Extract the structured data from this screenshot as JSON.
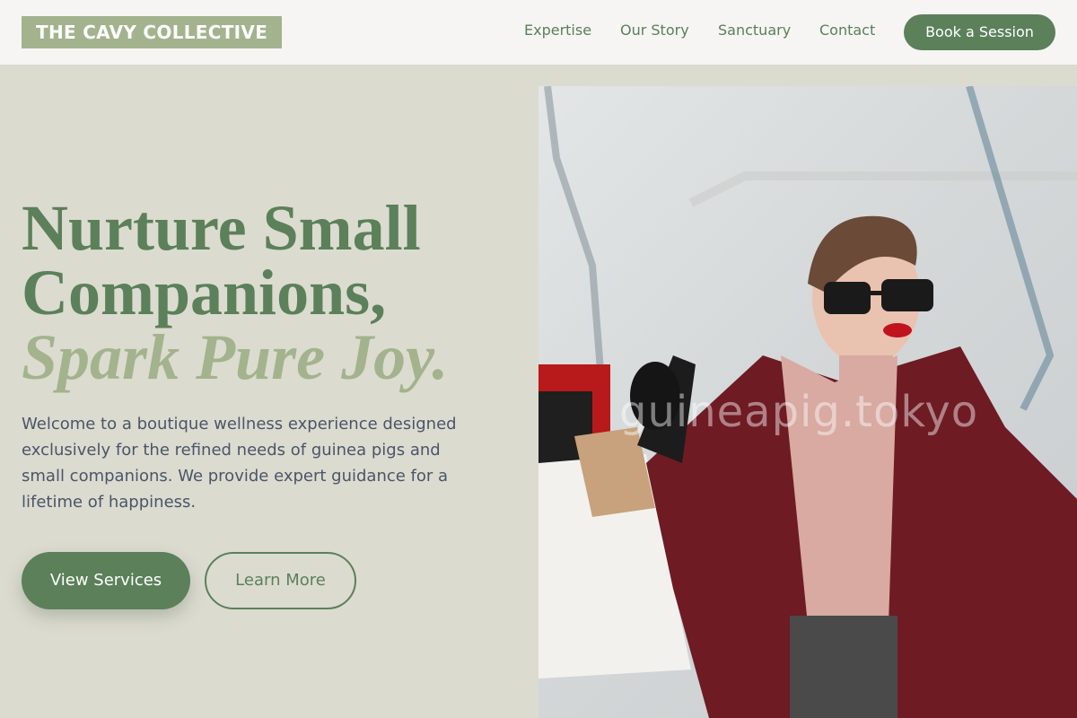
{
  "brand": {
    "logo_text": "THE CAVY COLLECTIVE"
  },
  "nav": {
    "items": [
      {
        "label": "Expertise"
      },
      {
        "label": "Our Story"
      },
      {
        "label": "Sanctuary"
      },
      {
        "label": "Contact"
      }
    ],
    "cta_label": "Book a Session"
  },
  "hero": {
    "title_line1": "Nurture Small",
    "title_line2": "Companions,",
    "title_accent": "Spark Pure Joy.",
    "description": "Welcome to a boutique wellness experience designed exclusively for the refined needs of guinea pigs and small companions. We provide expert guidance for a lifetime of happiness.",
    "primary_button": "View Services",
    "secondary_button": "Learn More"
  },
  "image": {
    "watermark": "guineapig.tokyo"
  },
  "colors": {
    "primary": "#5b805a",
    "accent": "#a3b38d",
    "background": "#dcdbd0",
    "header": "#f6f5f3"
  }
}
